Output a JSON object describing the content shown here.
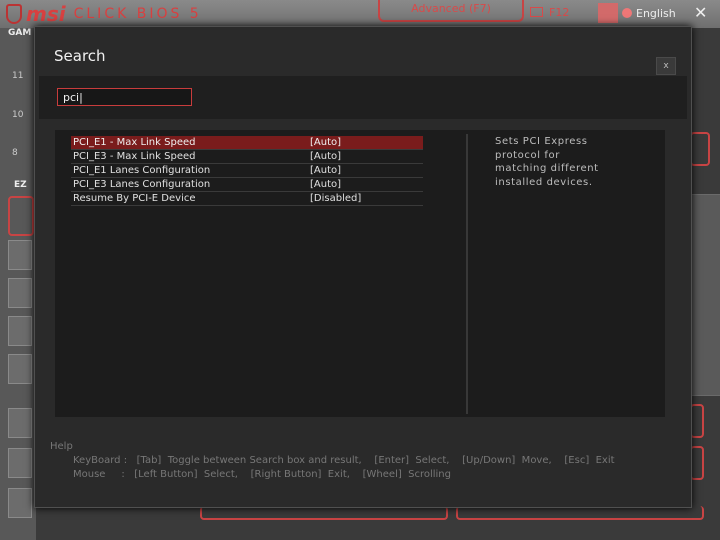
{
  "background": {
    "brand": "msi",
    "product": "CLICK BIOS 5",
    "advanced_tab": "Advanced (F7)",
    "f12_label": "F12",
    "language": "English",
    "side_numbers": [
      "11",
      "10",
      "8"
    ],
    "side_label_1": "GAM",
    "side_label_2": "EZ"
  },
  "dialog": {
    "title": "Search",
    "close_label": "x",
    "search_value": "pci|",
    "results": [
      {
        "name": "PCI_E1 - Max Link Speed",
        "value": "[Auto]",
        "selected": true
      },
      {
        "name": "PCI_E3 - Max Link Speed",
        "value": "[Auto]",
        "selected": false
      },
      {
        "name": "PCI_E1 Lanes Configuration",
        "value": "[Auto]",
        "selected": false
      },
      {
        "name": "PCI_E3 Lanes Configuration",
        "value": "[Auto]",
        "selected": false
      },
      {
        "name": "Resume By PCI-E Device",
        "value": "[Disabled]",
        "selected": false
      }
    ],
    "help_text": "Sets PCI Express protocol for matching different installed devices.",
    "footer": {
      "help_label": "Help",
      "keyboard_line": "KeyBoard :   [Tab]  Toggle between Search box and result,    [Enter]  Select,    [Up/Down]  Move,    [Esc]  Exit",
      "mouse_line": "Mouse     :   [Left Button]  Select,    [Right Button]  Exit,    [Wheel]  Scrolling"
    }
  },
  "colors": {
    "accent_red": "#c83c3c",
    "selected_row": "#7a1c1c",
    "dialog_bg": "#2a2a2a"
  }
}
